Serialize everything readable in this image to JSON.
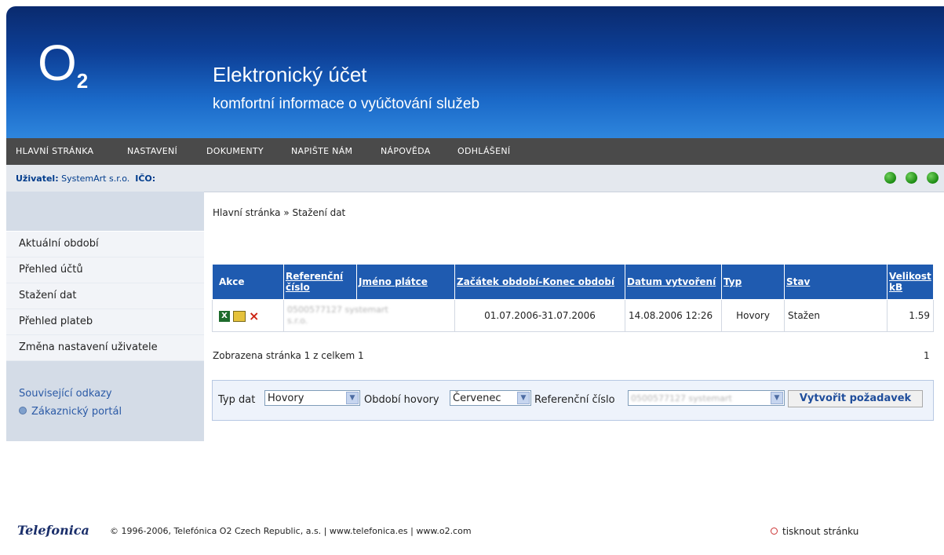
{
  "header": {
    "logo": "O",
    "logo_sub": "2",
    "title": "Elektronický účet",
    "subtitle": "komfortní informace o vyúčtování služeb"
  },
  "nav": {
    "items": [
      {
        "label": "HLAVNÍ STRÁNKA"
      },
      {
        "label": "NASTAVENÍ"
      },
      {
        "label": "DOKUMENTY"
      },
      {
        "label": "NAPIŠTE NÁM"
      },
      {
        "label": "NÁPOVĚDA"
      },
      {
        "label": "ODHLÁŠENÍ"
      }
    ]
  },
  "user": {
    "label": "Uživatel:",
    "name": "SystemArt s.r.o.",
    "ico_label": "IČO:"
  },
  "sidebar": {
    "items": [
      {
        "label": "Aktuální období"
      },
      {
        "label": "Přehled účtů"
      },
      {
        "label": "Stažení dat"
      },
      {
        "label": "Přehled plateb"
      },
      {
        "label": "Změna nastavení uživatele"
      }
    ],
    "related_heading": "Související odkazy",
    "related_link": "Zákaznický portál"
  },
  "breadcrumb": "Hlavní stránka » Stažení dat",
  "table": {
    "headers": {
      "akce": "Akce",
      "ref": "Referenční číslo",
      "name": "Jméno plátce",
      "period": "Začátek období-Konec období",
      "created": "Datum vytvoření",
      "type": "Typ",
      "state": "Stav",
      "size": "Velikost kB"
    },
    "row": {
      "ref_blurred": "0500577127 systemart",
      "name_blurred": "s.r.o.",
      "period": "01.07.2006-31.07.2006",
      "created": "14.08.2006 12:26",
      "type": "Hovory",
      "state": "Stažen",
      "size": "1.59"
    }
  },
  "pager": {
    "text": "Zobrazena stránka 1 z celkem 1",
    "page": "1"
  },
  "form": {
    "type_label": "Typ dat",
    "type_value": "Hovory",
    "period_label": "Období hovory",
    "period_value": "Červenec",
    "ref_label": "Referenční číslo",
    "ref_value_blurred": "0500577127 systemart",
    "submit": "Vytvořit požadavek"
  },
  "footer": {
    "logo": "Telefonica",
    "copyright": "© 1996-2006, Telefónica O2 Czech Republic, a.s. | www.telefonica.es | www.o2.com",
    "print": "tisknout stránku"
  },
  "colors": {
    "nav_bg": "#4a4a4a",
    "table_header": "#1f5bb0",
    "status_dots": "#1b8a12"
  }
}
